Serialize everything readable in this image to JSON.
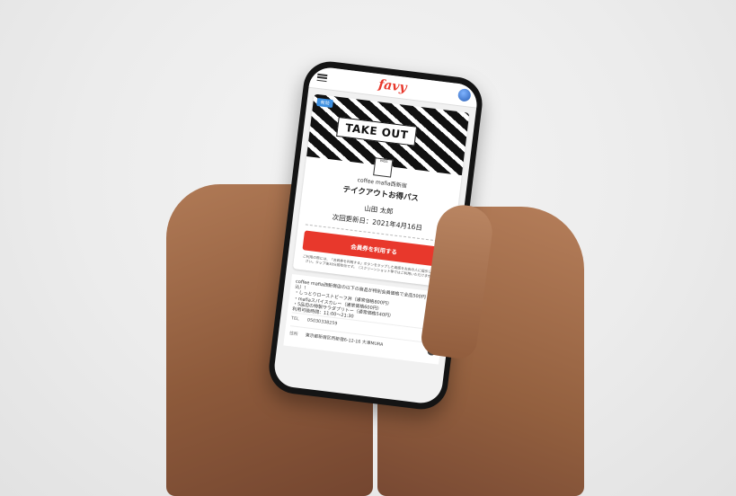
{
  "app": {
    "logo": "favy"
  },
  "card": {
    "badge": "有効",
    "banner_text": "TAKE OUT",
    "qr_label": "PASS",
    "shop_name": "coffee mafia西新宿",
    "pass_name": "テイクアウトお得パス",
    "member_name": "山田 太郎",
    "renewal_label": "次回更新日：2021年4月16日",
    "use_button": "会員券を利用する",
    "note": "ご利用の際には、「会員券を利用する」ボタンをタップした画面をお店の人に提示してください。タップ後30分間有効です。（スクリーンショット等ではご利用いただけません）"
  },
  "details": {
    "description": [
      "coffee mafia西新宿店の以下の商品が特別会員価格で全品500円（税込）！",
      "・しっとりローストビーフ丼（通常価格800円）",
      "・mafiaスパイスカレー（通常価格600円）",
      "・5品目の特製サラダプリトー（通常価格540円）",
      "利用可能時間：11:00〜21:30"
    ],
    "tel_label": "TEL",
    "tel_value": "05030338259",
    "address_label": "住所",
    "address_value": "東京都新宿区西新宿6-12-16 大津MURA"
  },
  "icons": {
    "menu": "hamburger-icon",
    "profile": "avatar-icon",
    "phone": "phone-icon",
    "map": "map-pin-icon"
  },
  "colors": {
    "brand": "#e8382c",
    "badge": "#3d8fe0"
  }
}
